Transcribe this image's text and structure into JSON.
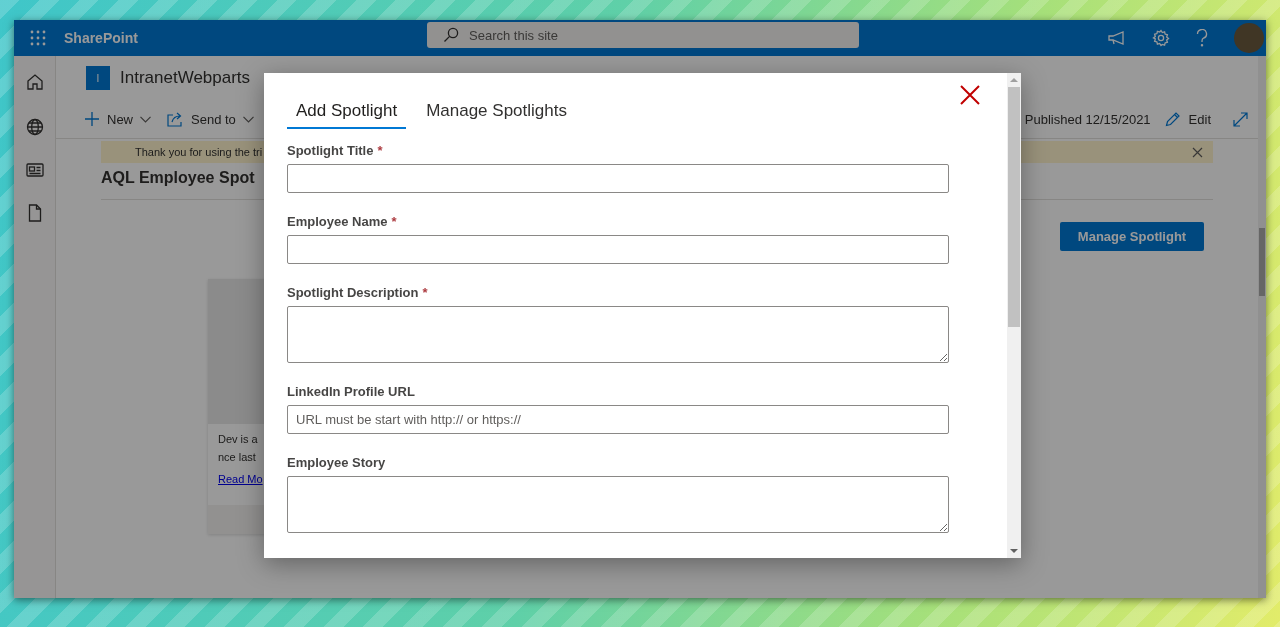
{
  "suite_bar": {
    "app_name": "SharePoint",
    "search": {
      "placeholder": "Search this site"
    }
  },
  "site": {
    "logo_letter": "I",
    "name": "IntranetWebparts"
  },
  "command_bar": {
    "items": [
      {
        "label": "New",
        "kind": "new"
      },
      {
        "label": "Send to",
        "kind": "send"
      }
    ],
    "published": "Published 12/15/2021",
    "edit": "Edit"
  },
  "banner": {
    "text": "Thank you for using the tri"
  },
  "page_title": "AQL Employee Spot",
  "manage_button": "Manage Spotlight",
  "card": {
    "lines": [
      "Dev is a",
      "nce last"
    ],
    "link": "Read Mo"
  },
  "dialog": {
    "required_mark": "*",
    "tabs": [
      {
        "label": "Add Spotlight",
        "selected": true
      },
      {
        "label": "Manage Spotlights",
        "selected": false
      }
    ],
    "fields": [
      {
        "label": "Spotlight Title",
        "required": true,
        "kind": "input"
      },
      {
        "label": "Employee Name",
        "required": true,
        "kind": "input"
      },
      {
        "label": "Spotlight Description",
        "required": true,
        "kind": "textarea"
      },
      {
        "label": "LinkedIn Profile URL",
        "required": false,
        "kind": "input",
        "placeholder": "URL must be start with http:// or https://"
      },
      {
        "label": "Employee Story",
        "required": false,
        "kind": "textarea"
      }
    ]
  }
}
